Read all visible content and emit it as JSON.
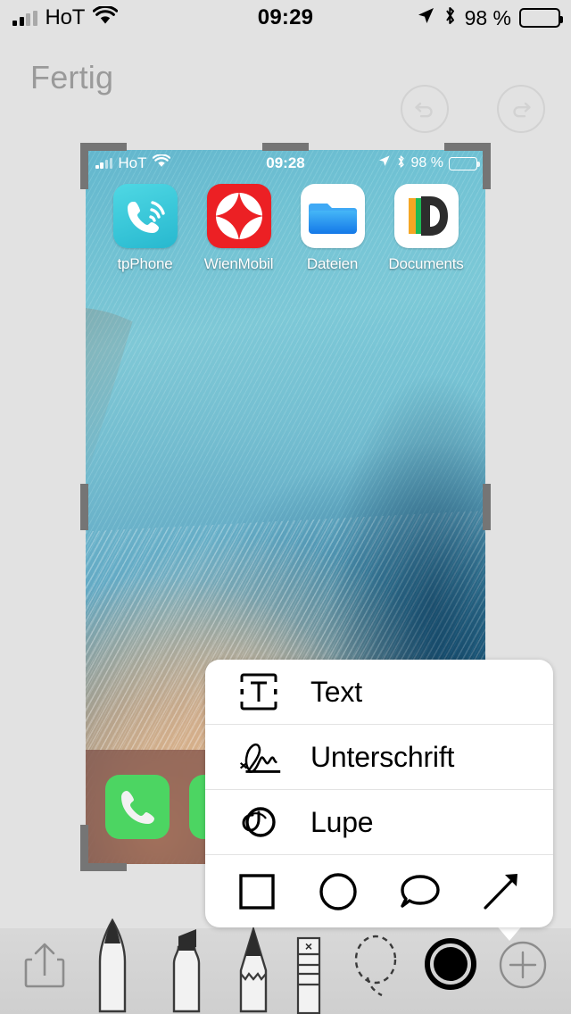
{
  "status_bar": {
    "carrier": "HoT",
    "time": "09:29",
    "battery_percent": "98 %",
    "signal_icon": "signal-bars-icon",
    "wifi_icon": "wifi-icon",
    "location_icon": "location-arrow-icon",
    "bluetooth_icon": "bluetooth-icon",
    "battery_icon": "battery-icon"
  },
  "navbar": {
    "done_label": "Fertig",
    "done_disabled": true,
    "undo_icon": "undo-icon",
    "redo_icon": "redo-icon"
  },
  "screenshot": {
    "status_bar": {
      "carrier": "HoT",
      "time": "09:28",
      "battery_percent": "98 %"
    },
    "apps": [
      {
        "label": "tpPhone",
        "icon": "tpphone-app-icon"
      },
      {
        "label": "WienMobil",
        "icon": "wienmobil-app-icon"
      },
      {
        "label": "Dateien",
        "icon": "dateien-app-icon"
      },
      {
        "label": "Documents",
        "icon": "documents-app-icon"
      }
    ],
    "dock": [
      {
        "label": "Telefon",
        "icon": "phone-app-icon"
      }
    ]
  },
  "popup": {
    "items": [
      {
        "label": "Text",
        "icon": "text-box-icon"
      },
      {
        "label": "Unterschrift",
        "icon": "signature-icon"
      },
      {
        "label": "Lupe",
        "icon": "magnifier-icon"
      }
    ],
    "shapes": [
      {
        "name": "square-shape-icon"
      },
      {
        "name": "circle-shape-icon"
      },
      {
        "name": "speech-bubble-shape-icon"
      },
      {
        "name": "arrow-shape-icon"
      }
    ]
  },
  "toolbar": {
    "tools": [
      {
        "name": "share-button"
      },
      {
        "name": "pen-tool"
      },
      {
        "name": "highlighter-tool"
      },
      {
        "name": "pencil-tool"
      },
      {
        "name": "eraser-tool"
      },
      {
        "name": "lasso-select-tool"
      },
      {
        "name": "color-swatch"
      },
      {
        "name": "add-markup-button"
      }
    ],
    "selected_color": "#000000"
  },
  "colors": {
    "background": "#e2e2e2",
    "toolbar": "#d4d4d4",
    "disabled_text": "#9a9a9a",
    "handle": "#757575"
  }
}
